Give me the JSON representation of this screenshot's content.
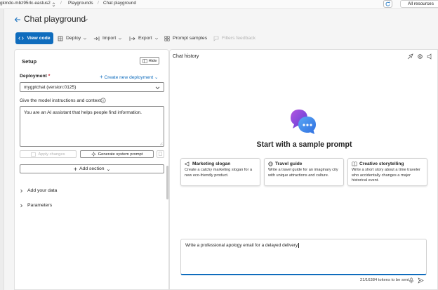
{
  "breadcrumb": {
    "resource": "gkmdo-mbz95rlc-eastus2",
    "playgrounds": "Playgrounds",
    "current": "Chat playground"
  },
  "top_right": {
    "all_resources": "All resources"
  },
  "page": {
    "title": "Chat playground"
  },
  "toolbar": {
    "view_code": "View code",
    "deploy": "Deploy",
    "import": "Import",
    "export": "Export",
    "prompt_samples": "Prompt samples",
    "filters_feedback": "Filters feedback"
  },
  "setup": {
    "title": "Setup",
    "hide": "Hide",
    "deployment_label": "Deployment",
    "required_mark": "*",
    "create_deployment": "Create new deployment",
    "deployment_value": "mygptchat (version:0125)",
    "instructions_label": "Give the model instructions and context",
    "instructions_value": "You are an AI assistant that helps people find information.",
    "apply_changes": "Apply changes",
    "generate_prompt": "Generate system prompt",
    "add_section": "Add section",
    "add_data": "Add your data",
    "parameters": "Parameters"
  },
  "chat": {
    "title": "Chat history",
    "start_title": "Start with a sample prompt",
    "cards": [
      {
        "title": "Marketing slogan",
        "desc": "Create a catchy marketing slogan for a new eco-friendly product.",
        "icon": "megaphone-icon"
      },
      {
        "title": "Travel guide",
        "desc": "Write a travel guide for an imaginary city with unique attractions and culture.",
        "icon": "globe-icon"
      },
      {
        "title": "Creative storytelling",
        "desc": "Write a short story about a time traveler who accidentally changes a major historical event.",
        "icon": "book-icon"
      }
    ],
    "prompt_value": "Write a professional apology email for a delayed delivery.",
    "tokens": "21/16384 tokens to be sent"
  },
  "colors": {
    "accent": "#0f6cbd",
    "required": "#c50f1f",
    "illustration_purple": "#8b5cf6",
    "illustration_blue": "#3b82f6"
  }
}
